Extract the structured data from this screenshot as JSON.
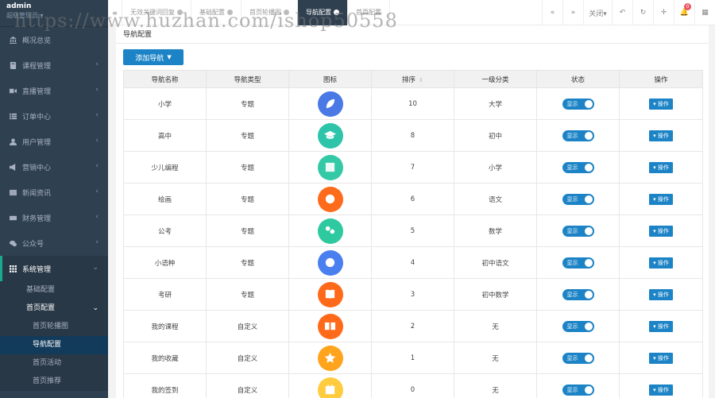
{
  "profile": {
    "name": "admin",
    "role": "超级管理员 ▾"
  },
  "sidebar": {
    "items": [
      {
        "label": "概况总览",
        "icon": "bank-icon",
        "arrow": ""
      },
      {
        "label": "课程管理",
        "icon": "book-icon",
        "arrow": "‹"
      },
      {
        "label": "直播管理",
        "icon": "video-icon",
        "arrow": "‹"
      },
      {
        "label": "订单中心",
        "icon": "list-icon",
        "arrow": "‹"
      },
      {
        "label": "用户管理",
        "icon": "user-icon",
        "arrow": "‹"
      },
      {
        "label": "营销中心",
        "icon": "megaphone-icon",
        "arrow": "‹"
      },
      {
        "label": "新闻资讯",
        "icon": "newspaper-icon",
        "arrow": "‹"
      },
      {
        "label": "财务管理",
        "icon": "money-icon",
        "arrow": "‹"
      },
      {
        "label": "公众号",
        "icon": "wechat-icon",
        "arrow": "‹"
      }
    ],
    "system": {
      "label": "系统管理",
      "arrow": "⌄"
    },
    "sub": {
      "basic": "基础配置",
      "home": "首页配置",
      "home_arrow": "⌄"
    },
    "subsub": [
      "首页轮播图",
      "导航配置",
      "首页活动",
      "首页推荐"
    ]
  },
  "topbar": {
    "tabs": [
      "无效关键词回复",
      "基础配置",
      "首页轮播图",
      "导航配置",
      "首页配置"
    ],
    "close_label": "关闭▾",
    "badge": "0"
  },
  "page": {
    "title": "导航配置",
    "add_button": "添加导航"
  },
  "table": {
    "headers": [
      "导航名称",
      "导航类型",
      "图标",
      "排序",
      "一级分类",
      "状态",
      "操作"
    ],
    "sort_icon": "⇕",
    "status_label": "显示",
    "op_label": "▾ 操作",
    "rows": [
      {
        "name": "小学",
        "type": "专题",
        "sort": "10",
        "cat": "大学",
        "icon": "leaf-icon",
        "color": "#4a79e6"
      },
      {
        "name": "高中",
        "type": "专题",
        "sort": "8",
        "cat": "初中",
        "icon": "graduation-cap-icon",
        "color": "#2ec4a9"
      },
      {
        "name": "少儿编程",
        "type": "专题",
        "sort": "7",
        "cat": "小学",
        "icon": "code-icon",
        "color": "#34c9a6"
      },
      {
        "name": "绘画",
        "type": "专题",
        "sort": "6",
        "cat": "语文",
        "icon": "palette-icon",
        "color": "#ff6b1c"
      },
      {
        "name": "公考",
        "type": "专题",
        "sort": "5",
        "cat": "数学",
        "icon": "people-icon",
        "color": "#2fc9a0"
      },
      {
        "name": "小语种",
        "type": "专题",
        "sort": "4",
        "cat": "初中语文",
        "icon": "globe-icon",
        "color": "#4a7ff0"
      },
      {
        "name": "考研",
        "type": "专题",
        "sort": "3",
        "cat": "初中数学",
        "icon": "book-open-icon",
        "color": "#ff6a1a"
      },
      {
        "name": "我的课程",
        "type": "自定义",
        "sort": "2",
        "cat": "无",
        "icon": "reader-icon",
        "color": "#ff6a1a"
      },
      {
        "name": "我的收藏",
        "type": "自定义",
        "sort": "1",
        "cat": "无",
        "icon": "star-icon",
        "color": "#ffa41c"
      },
      {
        "name": "我的签到",
        "type": "自定义",
        "sort": "0",
        "cat": "无",
        "icon": "calendar-check-icon",
        "color": "#ffcc40"
      }
    ]
  },
  "watermark": "https://www.huzhan.com/ishop50558"
}
